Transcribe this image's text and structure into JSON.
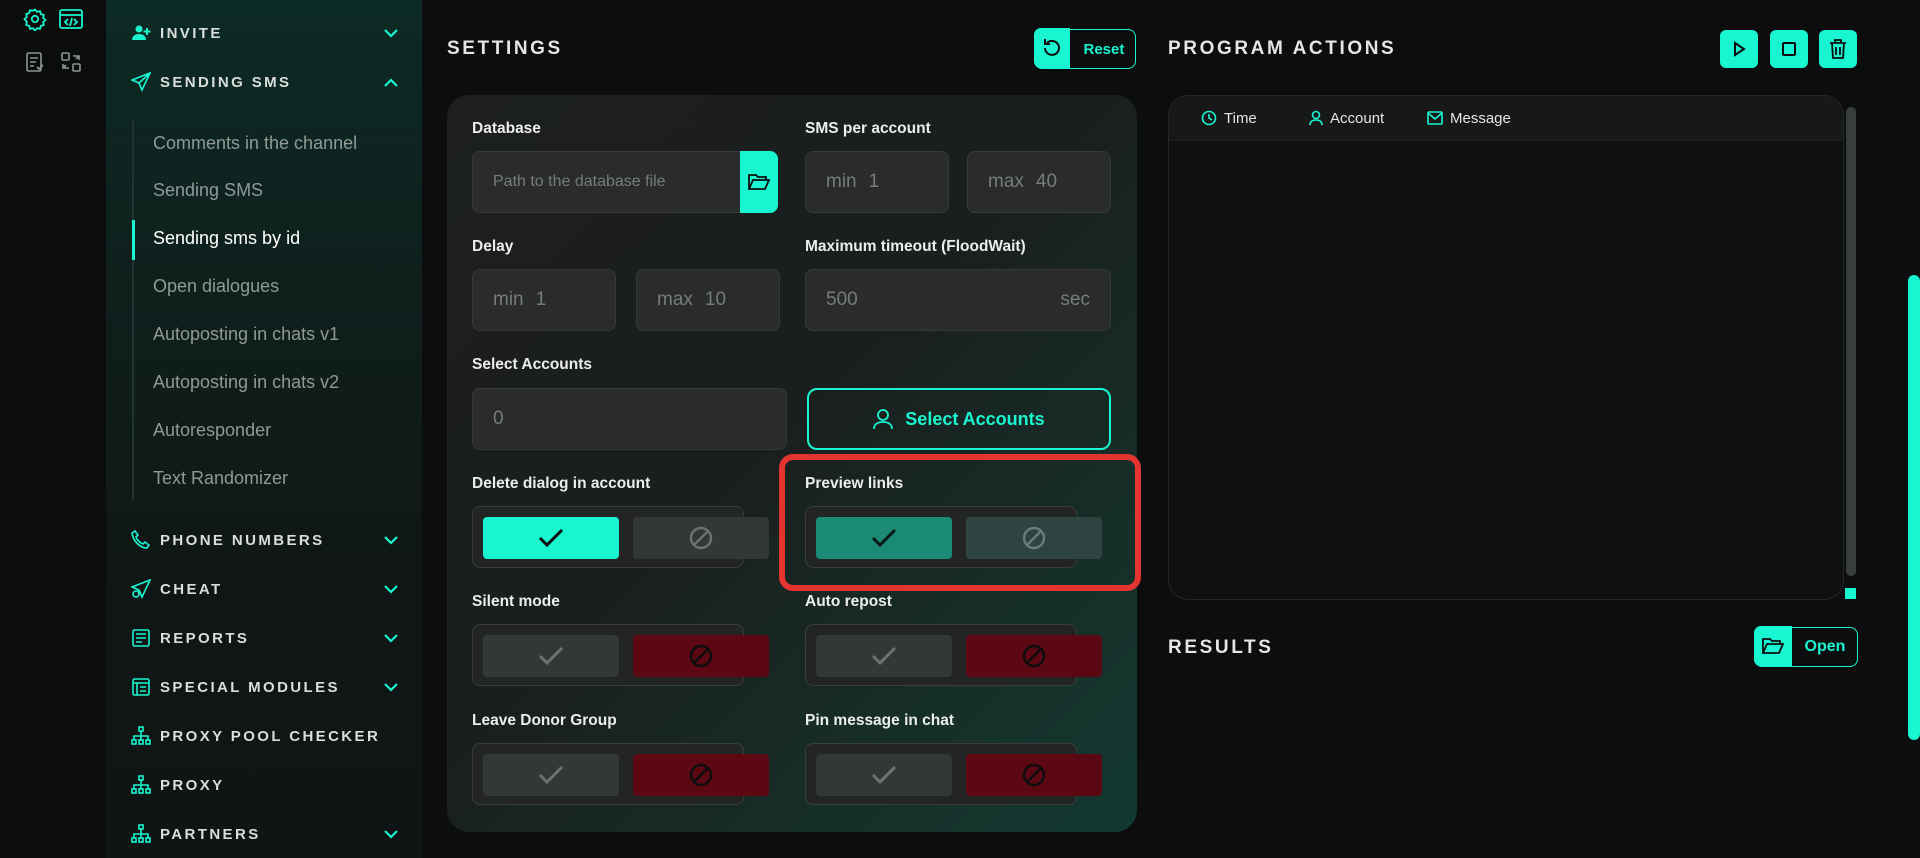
{
  "colors": {
    "accent": "#19f5d0",
    "danger": "#5c0812",
    "highlight": "#e3342f"
  },
  "sidebar": {
    "sections": [
      {
        "label": "INVITE",
        "icon": "user-plus-icon"
      },
      {
        "label": "SENDING SMS",
        "icon": "send-icon",
        "expanded": true
      },
      {
        "label": "PHONE NUMBERS",
        "icon": "phone-icon"
      },
      {
        "label": "CHEAT",
        "icon": "cheat-send-icon"
      },
      {
        "label": "REPORTS",
        "icon": "reports-icon"
      },
      {
        "label": "SPECIAL MODULES",
        "icon": "modules-icon"
      },
      {
        "label": "PROXY POOL CHECKER",
        "icon": "network-icon"
      },
      {
        "label": "PROXY",
        "icon": "network-icon"
      },
      {
        "label": "PARTNERS",
        "icon": "network-icon"
      }
    ],
    "sub_items": [
      "Comments in the channel",
      "Sending SMS",
      "Sending sms by id",
      "Open dialogues",
      "Autoposting in chats v1",
      "Autoposting in chats v2",
      "Autoresponder",
      "Text Randomizer"
    ],
    "active_sub": "Sending sms by id"
  },
  "settings": {
    "title": "SETTINGS",
    "reset_label": "Reset",
    "database": {
      "label": "Database",
      "placeholder": "Path to the database file"
    },
    "sms_per_account": {
      "label": "SMS per account",
      "min_label": "min",
      "min": "1",
      "max_label": "max",
      "max": "40"
    },
    "delay": {
      "label": "Delay",
      "min_label": "min",
      "min": "1",
      "max_label": "max",
      "max": "10"
    },
    "timeout": {
      "label": "Maximum timeout (FloodWait)",
      "value": "500",
      "unit": "sec"
    },
    "select_accounts": {
      "label": "Select Accounts",
      "count": "0",
      "button_label": "Select Accounts"
    },
    "toggles": {
      "delete_dialog": {
        "label": "Delete dialog in account",
        "state": "on"
      },
      "preview_links": {
        "label": "Preview links",
        "state": "on",
        "highlighted": true
      },
      "silent_mode": {
        "label": "Silent mode",
        "state": "off"
      },
      "auto_repost": {
        "label": "Auto repost",
        "state": "off"
      },
      "leave_donor": {
        "label": "Leave Donor Group",
        "state": "off"
      },
      "pin_message": {
        "label": "Pin message in chat",
        "state": "off"
      }
    }
  },
  "program": {
    "title": "PROGRAM ACTIONS",
    "columns": [
      "Time",
      "Account",
      "Message"
    ],
    "actions": [
      "play-icon",
      "stop-icon",
      "trash-icon"
    ]
  },
  "results": {
    "title": "RESULTS",
    "open_label": "Open"
  }
}
